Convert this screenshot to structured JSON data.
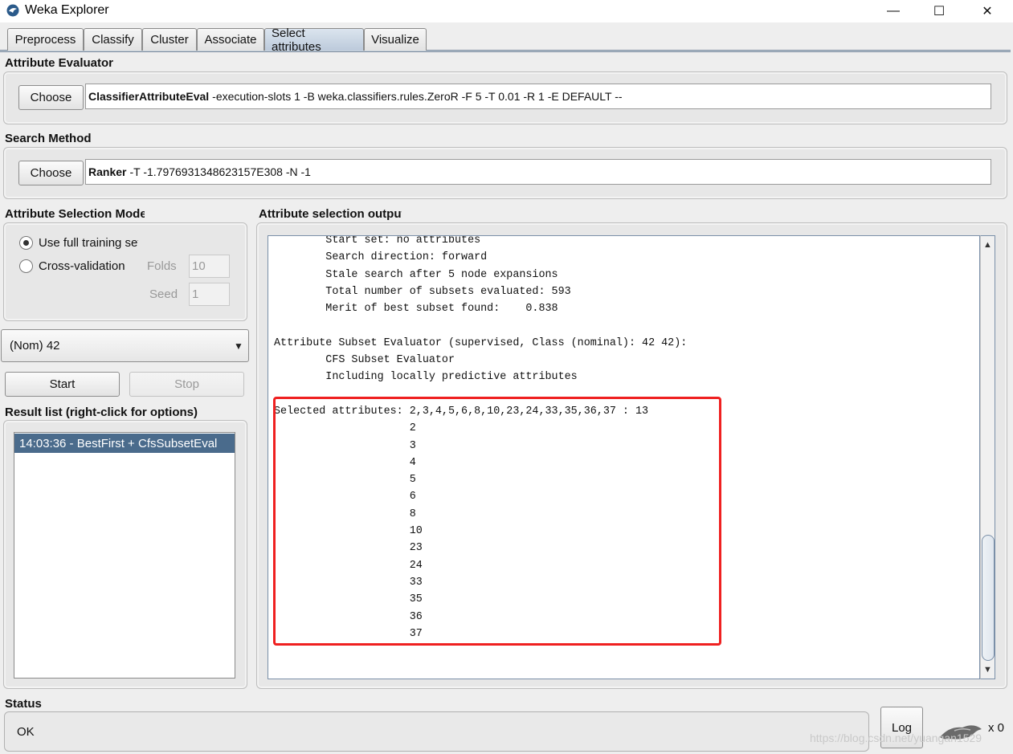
{
  "window": {
    "title": "Weka Explorer",
    "minimize": "—",
    "maximize": "☐",
    "close": "✕"
  },
  "tabs": [
    "Preprocess",
    "Classify",
    "Cluster",
    "Associate",
    "Select attributes",
    "Visualize"
  ],
  "active_tab": "Select attributes",
  "attribute_evaluator": {
    "label": "Attribute Evaluator",
    "choose_label": "Choose",
    "name": "ClassifierAttributeEval",
    "options": "-execution-slots 1 -B weka.classifiers.rules.ZeroR -F 5 -T 0.01 -R 1 -E DEFAULT --"
  },
  "search_method": {
    "label": "Search Method",
    "choose_label": "Choose",
    "name": "Ranker",
    "options": "-T -1.7976931348623157E308 -N -1"
  },
  "selection_mode": {
    "label": "Attribute Selection Mode",
    "use_full_training": "Use full training set",
    "cross_validation": "Cross-validation",
    "selected": "Use full training set",
    "folds_label": "Folds",
    "folds_value": "10",
    "seed_label": "Seed",
    "seed_value": "1"
  },
  "class_selector": {
    "value": "(Nom) 42"
  },
  "buttons": {
    "start": "Start",
    "stop": "Stop",
    "log": "Log"
  },
  "result_list": {
    "label": "Result list (right-click for options)",
    "items": [
      "14:03:36 - BestFirst + CfsSubsetEval"
    ]
  },
  "output": {
    "label": "Attribute selection output",
    "lines": [
      "        Start set: no attributes",
      "        Search direction: forward",
      "        Stale search after 5 node expansions",
      "        Total number of subsets evaluated: 593",
      "        Merit of best subset found:    0.838",
      "",
      "Attribute Subset Evaluator (supervised, Class (nominal): 42 42):",
      "        CFS Subset Evaluator",
      "        Including locally predictive attributes",
      "",
      "Selected attributes: 2,3,4,5,6,8,10,23,24,33,35,36,37 : 13",
      "                     2",
      "                     3",
      "                     4",
      "                     5",
      "                     6",
      "                     8",
      "                     10",
      "                     23",
      "                     24",
      "                     33",
      "                     35",
      "                     36",
      "                     37"
    ]
  },
  "status": {
    "label": "Status",
    "text": "OK",
    "count": "x 0"
  },
  "watermark": "https://blog.csdn.net/yuangan1529",
  "colors": {
    "highlight_box": "#ef2020",
    "selected_row": "#4a6b8c",
    "active_tab": "#c6d3e2"
  }
}
